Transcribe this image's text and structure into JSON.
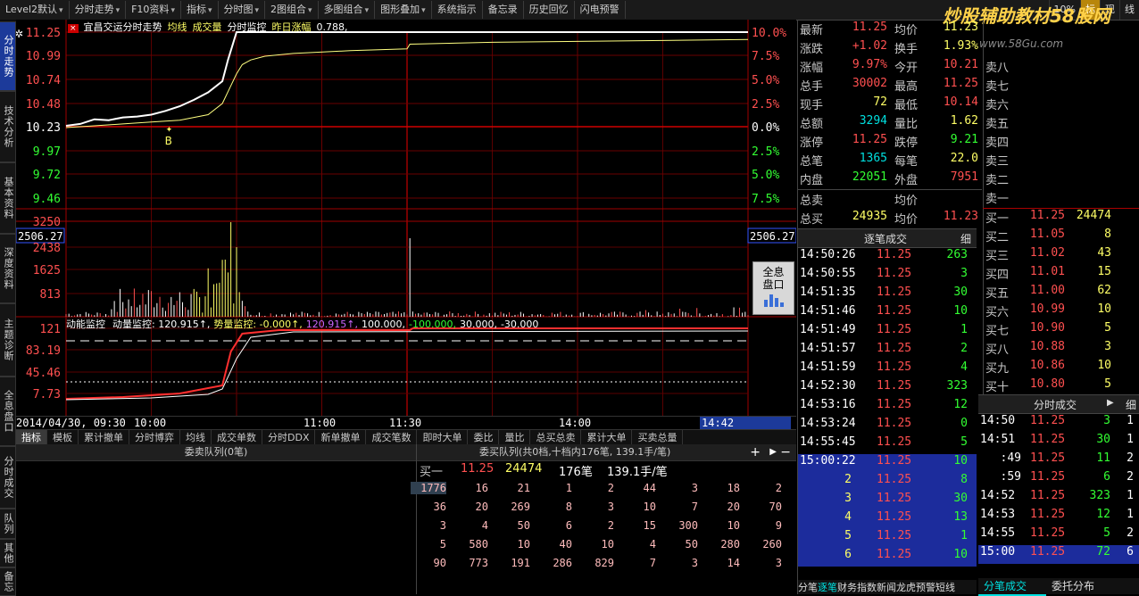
{
  "toolbar": {
    "items": [
      "Level2默认",
      "分时走势",
      "F10资料",
      "指标",
      "分时图",
      "2图组合",
      "多图组合",
      "图形叠加",
      "系统指示",
      "备忘录",
      "历史回忆",
      "闪电预警"
    ],
    "right": [
      "10%",
      "标",
      "现",
      "线"
    ],
    "watermark": "炒股辅助教材58股网",
    "watermark_url": "www.58Gu.com"
  },
  "left_tabs": [
    "分时走势",
    "技术分析",
    "基本资料",
    "深度资料",
    "主题诊断",
    "全息盘口",
    "分时成交",
    "队列",
    "其他",
    "备忘"
  ],
  "chart": {
    "stock_name": "宜昌交运分时走势",
    "legend": [
      "均线",
      "成交量",
      "分时监控",
      "昨日涨幅"
    ],
    "prev_change": "0.788,",
    "price_ticks": [
      "11.25",
      "10.99",
      "10.74",
      "10.48",
      "10.23",
      "9.97",
      "9.72",
      "9.46"
    ],
    "pct_ticks": [
      "10.0%",
      "7.5%",
      "5.0%",
      "2.5%",
      "0.0%",
      "2.5%",
      "5.0%",
      "7.5%"
    ],
    "vol_ticks": [
      "3250",
      "2438",
      "1625",
      "813"
    ],
    "index_left": "2506.27",
    "index_right": "2506.27",
    "marker": "B",
    "quanxi_label": "全息盘口",
    "sub_title": "动能监控",
    "sub_items": [
      "动量监控: 120.915↑,",
      "势量监控: -0.000↑,",
      "120.915↑,",
      "100.000,",
      "-100.000,",
      "30.000,",
      "-30.000"
    ],
    "sub_ticks": [
      "121",
      "83.19",
      "45.46",
      "7.73"
    ],
    "time_labels": [
      "2014/04/30, 09:30",
      "10:00",
      "11:00",
      "11:30",
      "14:00"
    ],
    "cursor_time": "14:42",
    "series": [
      {
        "name": "价格",
        "x": [
          0,
          5,
          10,
          15,
          20,
          25,
          30,
          35,
          40,
          45,
          50,
          55,
          57,
          60,
          61,
          62,
          65,
          70,
          75,
          80,
          90,
          100,
          120,
          150,
          180,
          210,
          240
        ],
        "y": [
          10.24,
          10.26,
          10.31,
          10.3,
          10.33,
          10.34,
          10.36,
          10.4,
          10.45,
          10.52,
          10.6,
          10.72,
          10.95,
          11.25,
          11.25,
          11.25,
          11.25,
          11.25,
          11.25,
          11.25,
          11.25,
          11.25,
          11.25,
          11.25,
          11.25,
          11.25,
          11.25
        ]
      },
      {
        "name": "均价",
        "x": [
          0,
          10,
          20,
          30,
          40,
          50,
          55,
          60,
          62,
          65,
          70,
          80,
          100,
          120,
          121,
          150,
          180,
          210,
          240
        ],
        "y": [
          10.22,
          10.24,
          10.26,
          10.28,
          10.3,
          10.36,
          10.48,
          10.8,
          10.9,
          10.95,
          10.99,
          11.02,
          11.05,
          11.07,
          11.12,
          11.14,
          11.15,
          11.16,
          11.17
        ]
      }
    ]
  },
  "bottom_tabs": [
    "指标",
    "模板",
    "累计撤单",
    "分时博弈",
    "均线",
    "成交单数",
    "分时DDX",
    "新单撤单",
    "成交笔数",
    "即时大单",
    "委比",
    "量比",
    "总买总卖",
    "累计大单",
    "买卖总量"
  ],
  "queue": {
    "sell_title": "委卖队列(0笔)",
    "buy_title": "委买队列(共0档,十档内176笔, 139.1手/笔)",
    "buy_summary": [
      "买一",
      "11.25",
      "24474",
      "176笔",
      "139.1手/笔"
    ],
    "rows": [
      [
        "1776",
        "16",
        "21",
        "1",
        "2",
        "44",
        "3",
        "18",
        "2"
      ],
      [
        "36",
        "20",
        "269",
        "8",
        "3",
        "10",
        "7",
        "20",
        "70"
      ],
      [
        "3",
        "4",
        "50",
        "6",
        "2",
        "15",
        "300",
        "10",
        "9"
      ],
      [
        "5",
        "580",
        "10",
        "40",
        "10",
        "4",
        "50",
        "280",
        "260"
      ],
      [
        "90",
        "773",
        "191",
        "286",
        "829",
        "7",
        "3",
        "14",
        "3"
      ]
    ]
  },
  "quote": {
    "rows": [
      [
        "最新",
        "11.25",
        "均价",
        "11.23"
      ],
      [
        "涨跌",
        "+1.02",
        "换手",
        "1.93%"
      ],
      [
        "涨幅",
        "9.97%",
        "今开",
        "10.21"
      ],
      [
        "总手",
        "30002",
        "最高",
        "11.25"
      ],
      [
        "现手",
        "72",
        "最低",
        "10.14"
      ],
      [
        "总额",
        "3294",
        "量比",
        "1.62"
      ],
      [
        "涨停",
        "11.25",
        "跌停",
        "9.21"
      ],
      [
        "总笔",
        "1365",
        "每笔",
        "22.0"
      ],
      [
        "内盘",
        "22051",
        "外盘",
        "7951"
      ]
    ],
    "sell_side": [
      "总卖",
      "均价"
    ],
    "buy_side": [
      "总买",
      "24935",
      "均价",
      "11.23"
    ]
  },
  "order_book": {
    "sells": [
      "卖八",
      "卖七",
      "卖六",
      "卖五",
      "卖四",
      "卖三",
      "卖二",
      "卖一"
    ],
    "buys": [
      [
        "买一",
        "11.25",
        "24474"
      ],
      [
        "买二",
        "11.05",
        "8"
      ],
      [
        "买三",
        "11.02",
        "43"
      ],
      [
        "买四",
        "11.01",
        "15"
      ],
      [
        "买五",
        "11.00",
        "62"
      ],
      [
        "买六",
        "10.99",
        "10"
      ],
      [
        "买七",
        "10.90",
        "5"
      ],
      [
        "买八",
        "10.88",
        "3"
      ],
      [
        "买九",
        "10.86",
        "10"
      ],
      [
        "买十",
        "10.80",
        "5"
      ]
    ]
  },
  "tick_trades": {
    "title": "逐笔成交",
    "detail": "细",
    "rows": [
      [
        "14:50:26",
        "11.25",
        "263"
      ],
      [
        "14:50:55",
        "11.25",
        "3"
      ],
      [
        "14:51:35",
        "11.25",
        "30"
      ],
      [
        "14:51:46",
        "11.25",
        "10"
      ],
      [
        "14:51:49",
        "11.25",
        "1"
      ],
      [
        "14:51:57",
        "11.25",
        "2"
      ],
      [
        "14:51:59",
        "11.25",
        "4"
      ],
      [
        "14:52:30",
        "11.25",
        "323"
      ],
      [
        "14:53:16",
        "11.25",
        "12"
      ],
      [
        "14:53:24",
        "11.25",
        "0"
      ],
      [
        "14:55:45",
        "11.25",
        "5"
      ],
      [
        "15:00:22",
        "11.25",
        "10"
      ],
      [
        "2",
        "11.25",
        "8"
      ],
      [
        "3",
        "11.25",
        "30"
      ],
      [
        "4",
        "11.25",
        "13"
      ],
      [
        "5",
        "11.25",
        "1"
      ],
      [
        "6",
        "11.25",
        "10"
      ]
    ],
    "footer": [
      "分笔",
      "逐笔",
      "财务",
      "指数",
      "新闻",
      "龙虎",
      "预警",
      "短线"
    ]
  },
  "minute_trades": {
    "title": "分时成交",
    "detail": "细",
    "rows": [
      [
        "14:50",
        "11.25",
        "3",
        "1"
      ],
      [
        "14:51",
        "11.25",
        "30",
        "1"
      ],
      [
        ":49",
        "11.25",
        "11",
        "2"
      ],
      [
        ":59",
        "11.25",
        "6",
        "2"
      ],
      [
        "14:52",
        "11.25",
        "323",
        "1"
      ],
      [
        "14:53",
        "11.25",
        "12",
        "1"
      ],
      [
        "14:55",
        "11.25",
        "5",
        "2"
      ],
      [
        "15:00",
        "11.25",
        "72",
        "6"
      ]
    ],
    "footer": [
      "分笔成交",
      "委托分布"
    ]
  }
}
